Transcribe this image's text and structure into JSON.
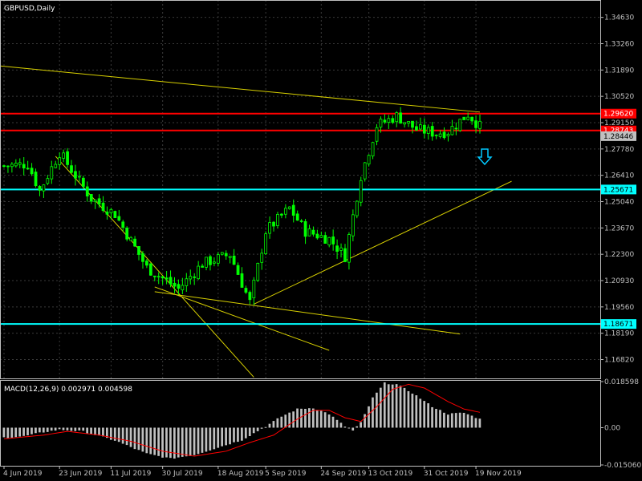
{
  "chart_data": [
    {
      "type": "candlestick",
      "title": "GBPUSD,Daily",
      "y_ticks": [
        "1.34630",
        "1.33260",
        "1.31890",
        "1.30520",
        "1.29150",
        "1.27780",
        "1.26410",
        "1.25040",
        "1.23670",
        "1.22300",
        "1.20930",
        "1.19560",
        "1.18190",
        "1.16820"
      ],
      "ylim": [
        1.1584,
        1.3545
      ],
      "x_ticks": [
        {
          "label": "4 Jun 2019",
          "bar": 0
        },
        {
          "label": "23 Jun 2019",
          "bar": 14
        },
        {
          "label": "11 Jul 2019",
          "bar": 27
        },
        {
          "label": "30 Jul 2019",
          "bar": 40
        },
        {
          "label": "18 Aug 2019",
          "bar": 54
        },
        {
          "label": "5 Sep 2019",
          "bar": 66
        },
        {
          "label": "24 Sep 2019",
          "bar": 80
        },
        {
          "label": "13 Oct 2019",
          "bar": 92
        },
        {
          "label": "31 Oct 2019",
          "bar": 106
        },
        {
          "label": "19 Nov 2019",
          "bar": 119
        }
      ],
      "anchors": [
        [
          0,
          1.269
        ],
        [
          6,
          1.27
        ],
        [
          9,
          1.256
        ],
        [
          14,
          1.276
        ],
        [
          22,
          1.252
        ],
        [
          28,
          1.244
        ],
        [
          36,
          1.216
        ],
        [
          44,
          1.205
        ],
        [
          50,
          1.218
        ],
        [
          57,
          1.223
        ],
        [
          62,
          1.198
        ],
        [
          66,
          1.235
        ],
        [
          72,
          1.247
        ],
        [
          76,
          1.235
        ],
        [
          82,
          1.231
        ],
        [
          86,
          1.222
        ],
        [
          90,
          1.264
        ],
        [
          94,
          1.29
        ],
        [
          99,
          1.295
        ],
        [
          104,
          1.288
        ],
        [
          109,
          1.286
        ],
        [
          112,
          1.287
        ],
        [
          117,
          1.296
        ],
        [
          120,
          1.2895
        ]
      ],
      "horizontal_levels": [
        {
          "label": "1.29620",
          "value": 1.2962,
          "color": "#ff0000"
        },
        {
          "label": "1.28743",
          "value": 1.28743,
          "color": "#ff0000"
        },
        {
          "label": "1.28446",
          "value": 1.28446,
          "color": "#c0c0c0"
        },
        {
          "label": "1.25671",
          "value": 1.25671,
          "color": "#00ffff"
        },
        {
          "label": "1.18671",
          "value": 1.18671,
          "color": "#00ffff"
        }
      ],
      "trendlines": [
        {
          "from": [
            -1,
            1.321
          ],
          "to": [
            120,
            1.297
          ],
          "color": "#d8d000"
        },
        {
          "from": [
            13,
            1.274
          ],
          "to": [
            63,
            1.159
          ],
          "color": "#d8d000"
        },
        {
          "from": [
            38,
            1.206
          ],
          "to": [
            82,
            1.173
          ],
          "color": "#d8d000"
        },
        {
          "from": [
            38,
            1.2035
          ],
          "to": [
            115,
            1.1815
          ],
          "color": "#d8d000"
        },
        {
          "from": [
            63,
            1.197
          ],
          "to": [
            128,
            1.261
          ],
          "color": "#d8d000"
        }
      ],
      "signal": {
        "direction": "down",
        "icon": "down-arrow-icon",
        "color": "#00c8ff"
      },
      "colors": {
        "candle": "#00ff00",
        "grid": "#3a3a3a",
        "axis": "#c0c0c0"
      }
    },
    {
      "type": "bar",
      "title": "MACD(12,26,9) 0.002971 0.004598",
      "y_ticks": [
        "0.018598",
        "0.00",
        "-0.015060"
      ],
      "ylim": [
        -0.01506,
        0.018598
      ],
      "histogram_anchors": [
        [
          0,
          -0.004
        ],
        [
          5,
          -0.0035
        ],
        [
          10,
          -0.0018
        ],
        [
          14,
          -0.0008
        ],
        [
          20,
          -0.0015
        ],
        [
          28,
          -0.0052
        ],
        [
          36,
          -0.0105
        ],
        [
          42,
          -0.0125
        ],
        [
          48,
          -0.011
        ],
        [
          56,
          -0.007
        ],
        [
          60,
          -0.005
        ],
        [
          66,
          0.0005
        ],
        [
          70,
          0.0045
        ],
        [
          74,
          0.0075
        ],
        [
          78,
          0.008
        ],
        [
          82,
          0.0055
        ],
        [
          86,
          0.0005
        ],
        [
          88,
          -0.0012
        ],
        [
          90,
          0.002
        ],
        [
          93,
          0.012
        ],
        [
          96,
          0.018
        ],
        [
          99,
          0.0175
        ],
        [
          103,
          0.014
        ],
        [
          108,
          0.0085
        ],
        [
          112,
          0.0055
        ],
        [
          116,
          0.006
        ],
        [
          120,
          0.0035
        ]
      ],
      "signal_anchors": [
        [
          0,
          -0.0045
        ],
        [
          10,
          -0.003
        ],
        [
          16,
          -0.0015
        ],
        [
          24,
          -0.003
        ],
        [
          32,
          -0.0055
        ],
        [
          40,
          -0.0095
        ],
        [
          48,
          -0.0115
        ],
        [
          56,
          -0.0095
        ],
        [
          62,
          -0.006
        ],
        [
          68,
          -0.003
        ],
        [
          74,
          0.0035
        ],
        [
          78,
          0.007
        ],
        [
          82,
          0.007
        ],
        [
          86,
          0.004
        ],
        [
          90,
          0.0025
        ],
        [
          94,
          0.0085
        ],
        [
          98,
          0.0155
        ],
        [
          102,
          0.0175
        ],
        [
          106,
          0.016
        ],
        [
          112,
          0.0105
        ],
        [
          116,
          0.0075
        ],
        [
          120,
          0.0062
        ]
      ],
      "colors": {
        "histogram": "#c0c0c0",
        "signal": "#ff0000"
      }
    }
  ]
}
